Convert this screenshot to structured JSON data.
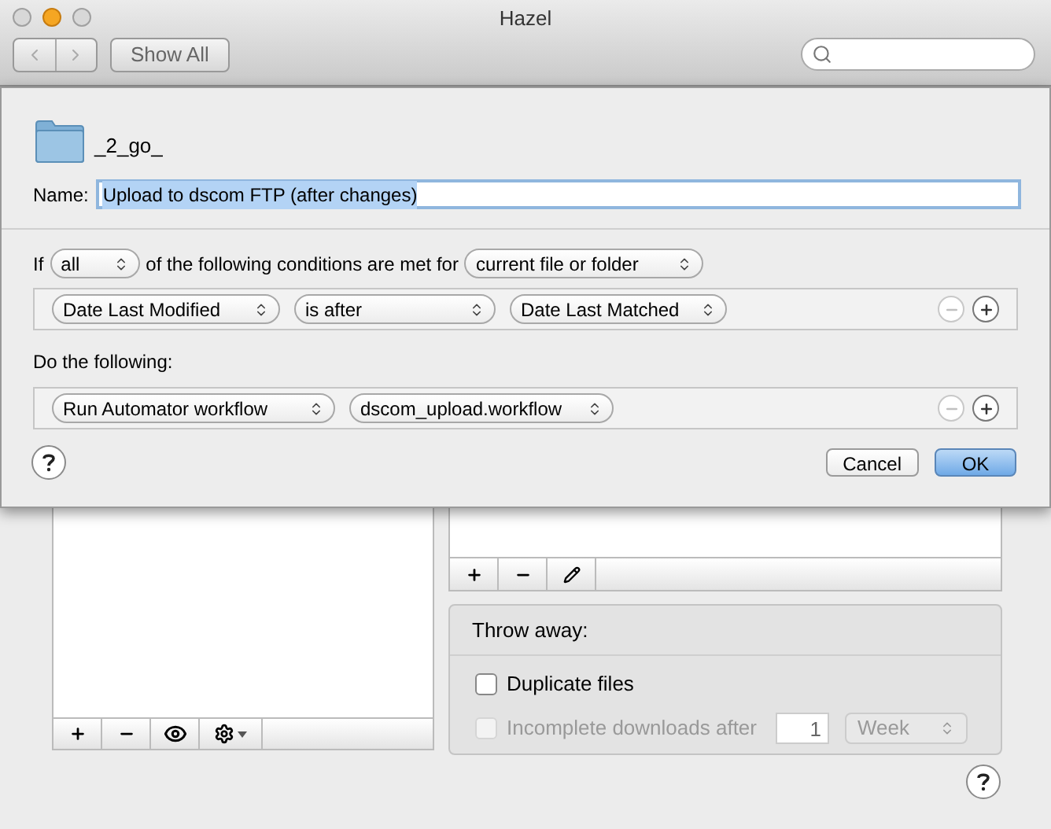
{
  "window": {
    "title": "Hazel",
    "toolbar": {
      "show_all": "Show All"
    }
  },
  "sheet": {
    "folder": "_2_go_",
    "name_label": "Name:",
    "name_value": "Upload to dscom FTP (after changes)",
    "conditions": {
      "prefix": "If",
      "match": "all",
      "middle": "of the following conditions are met for",
      "target": "current file or folder",
      "rows": [
        {
          "fields": [
            "Date Last Modified",
            "is after",
            "Date Last Matched"
          ],
          "remove_disabled": true
        }
      ]
    },
    "actions": {
      "label": "Do the following:",
      "rows": [
        {
          "fields": [
            "Run Automator workflow",
            "dscom_upload.workflow"
          ],
          "remove_disabled": true
        }
      ]
    },
    "buttons": [
      {
        "label": "Cancel",
        "default": false
      },
      {
        "label": "OK",
        "default": true
      }
    ]
  },
  "throw_away": {
    "title": "Throw away:",
    "options": [
      {
        "label": "Duplicate files",
        "checked": false,
        "disabled": false
      },
      {
        "label": "Incomplete downloads after",
        "checked": false,
        "disabled": true,
        "amount": "1",
        "unit": "Week"
      }
    ]
  }
}
